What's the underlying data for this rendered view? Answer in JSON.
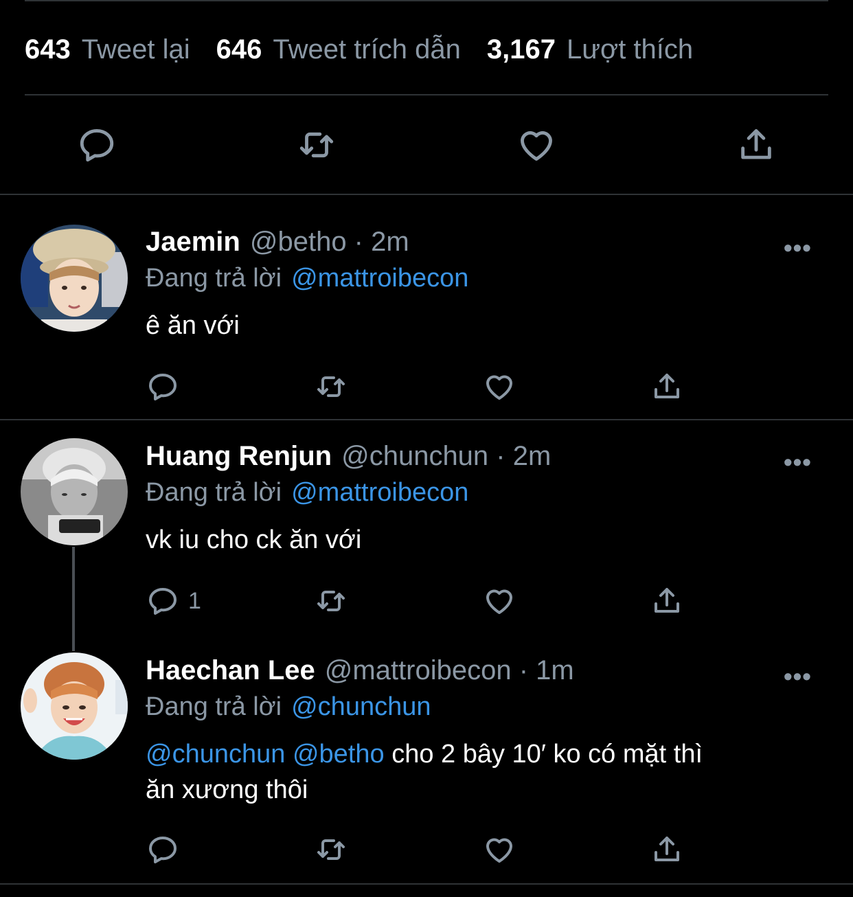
{
  "stats": {
    "retweets": {
      "count": "643",
      "label": "Tweet lại"
    },
    "quotes": {
      "count": "646",
      "label": "Tweet trích dẫn"
    },
    "likes": {
      "count": "3,167",
      "label": "Lượt thích"
    }
  },
  "main_actions": [
    "reply-icon",
    "retweet-icon",
    "like-icon",
    "share-icon"
  ],
  "replying_label": "Đang trả lời",
  "more_label": "•••",
  "replies": [
    {
      "display_name": "Jaemin",
      "meta": "@betho · 2m",
      "replying_to": "@mattroibecon",
      "text": "ê ăn với",
      "reply_count": ""
    },
    {
      "display_name": "Huang Renjun",
      "meta": "@chunchun · 2m",
      "replying_to": "@mattroibecon",
      "text": "vk iu cho ck ăn với",
      "reply_count": "1"
    },
    {
      "display_name": "Haechan Lee",
      "meta": "@mattroibecon · 1m",
      "replying_to": "@chunchun",
      "mention1": "@chunchun",
      "mention2": "@betho",
      "text_line1": "cho 2 bây 10′ ko có mặt thì",
      "text_line2": "ăn xương thôi",
      "reply_count": ""
    }
  ],
  "colors": {
    "accent": "#3b95e6",
    "muted": "#8b98a5",
    "background": "#000000"
  }
}
